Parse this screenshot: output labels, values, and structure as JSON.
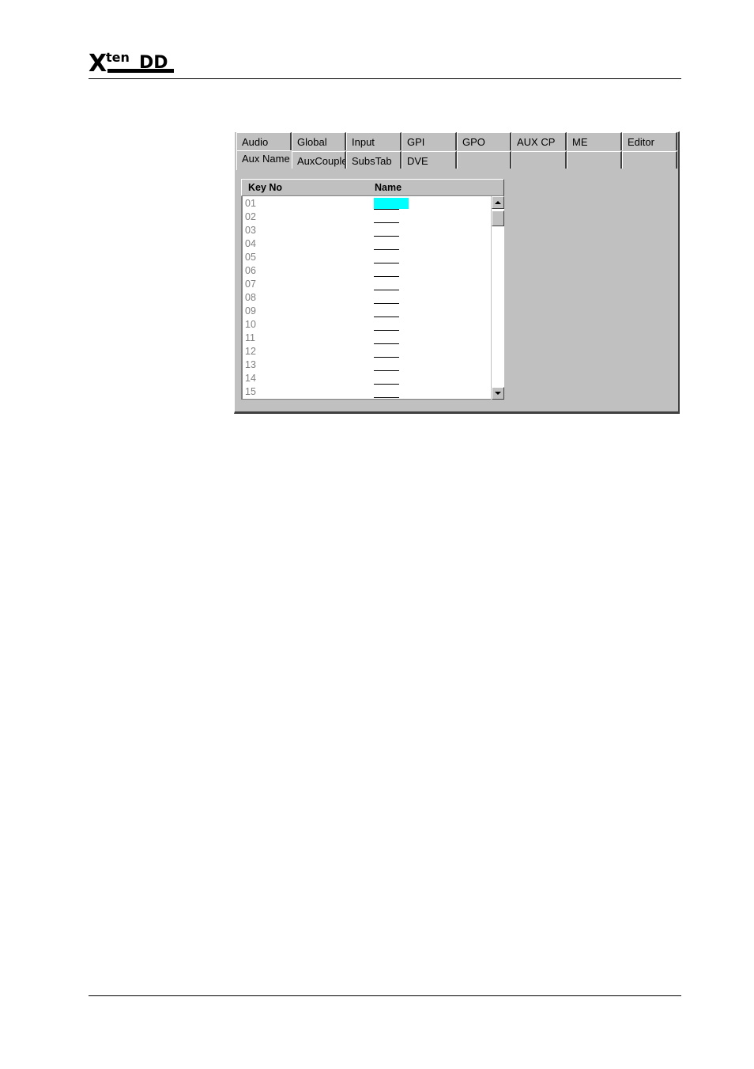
{
  "logo": {
    "text": "Xten DD"
  },
  "tabs_row1": [
    "Audio",
    "Global",
    "Input",
    "GPI",
    "GPO",
    "AUX CP",
    "ME",
    "Editor"
  ],
  "tabs_row2": [
    "Aux Name",
    "AuxCouple",
    "SubsTab",
    "DVE",
    "",
    "",
    "",
    ""
  ],
  "active_tab": "Aux Name",
  "table": {
    "headers": {
      "key": "Key No",
      "name": "Name"
    },
    "rows": [
      "01",
      "02",
      "03",
      "04",
      "05",
      "06",
      "07",
      "08",
      "09",
      "10",
      "11",
      "12",
      "13",
      "14",
      "15"
    ],
    "selected_row": "01"
  },
  "colors": {
    "panel": "#c0c0c0",
    "selection": "#00ffff"
  }
}
